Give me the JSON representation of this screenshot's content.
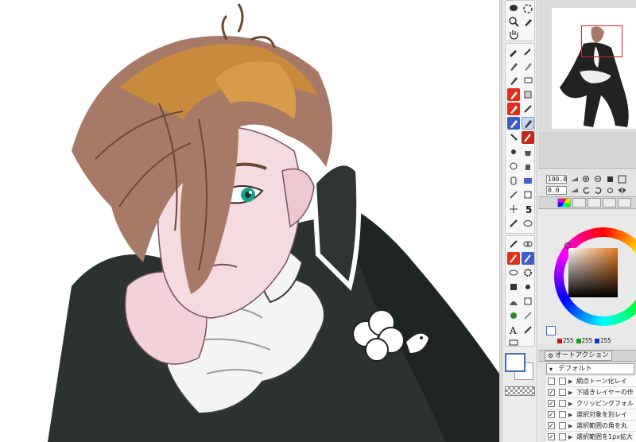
{
  "navigator": {
    "zoom_value": "100.0",
    "angle_value": "0.0"
  },
  "color": {
    "current": "#e67a20",
    "foreground": "#ffffff",
    "r_value": "255",
    "g_value": "255",
    "b_value": "255",
    "r_color": "#d01010",
    "g_color": "#10a010",
    "b_color": "#1030d0"
  },
  "auto_action": {
    "tab_label": "オートアクション",
    "set_name": "デフォルト",
    "items": [
      {
        "label": "網点トーン化レイ",
        "checked": false
      },
      {
        "label": "下描きレイヤーの作",
        "checked": true
      },
      {
        "label": "クリッピングフォル",
        "checked": true
      },
      {
        "label": "選択対象を別レイ",
        "checked": true
      },
      {
        "label": "選択範囲の角を丸",
        "checked": true
      },
      {
        "label": "選択範囲を1px拡大",
        "checked": true
      }
    ]
  },
  "icons": {
    "tools": [
      "lasso-icon",
      "rotate-icon",
      "zoom-icon",
      "eyedropper-icon",
      "hand-icon",
      "pen-icon",
      "pencil-icon",
      "brush-icon",
      "marker-icon",
      "eraser-icon",
      "bucket-icon",
      "text-icon"
    ]
  }
}
